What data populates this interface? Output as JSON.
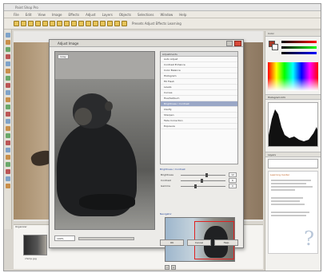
{
  "app": {
    "titlebar_text": "Paint Shop Pro",
    "menu": [
      "File",
      "Edit",
      "View",
      "Image",
      "Effects",
      "Adjust",
      "Layers",
      "Objects",
      "Selections",
      "Window",
      "Help"
    ],
    "toolbar_text": "Presets  Adjust  Effects  Learning"
  },
  "dialog": {
    "title": "Adjust Image",
    "preview_chip": "Gray",
    "filters_header": "Adjustments",
    "filters": [
      "Auto Adjust",
      "Contrast Enhance",
      "Color Balance",
      "Histogram",
      "Fill Flash",
      "Levels",
      "Curves",
      "Hue/Sat/Lum",
      "Brightness / Contrast",
      "Clarify",
      "Sharpen",
      "Fade Correction",
      "Exposure"
    ],
    "selected_filter_index": 8,
    "adjust_title": "Brightness / Contrast",
    "sliders": [
      {
        "label": "Brightness",
        "value": "12",
        "level": 0.55
      },
      {
        "label": "Contrast",
        "value": "6",
        "level": 0.45
      },
      {
        "label": "Gamma",
        "value": "0",
        "level": 0.3
      }
    ],
    "navigator_title": "Navigator",
    "zoom_value": "100%",
    "buttons": {
      "ok": "OK",
      "cancel": "Cancel",
      "help": "Help"
    }
  },
  "right_panel": {
    "color_tab": "Color",
    "histogram_tab": "Histogram  Info",
    "layers_tab": "Layers",
    "help_title": "Learning Center"
  },
  "bottom_panel": {
    "tab": "Organizer",
    "thumb_label": "chimp.jpg"
  }
}
